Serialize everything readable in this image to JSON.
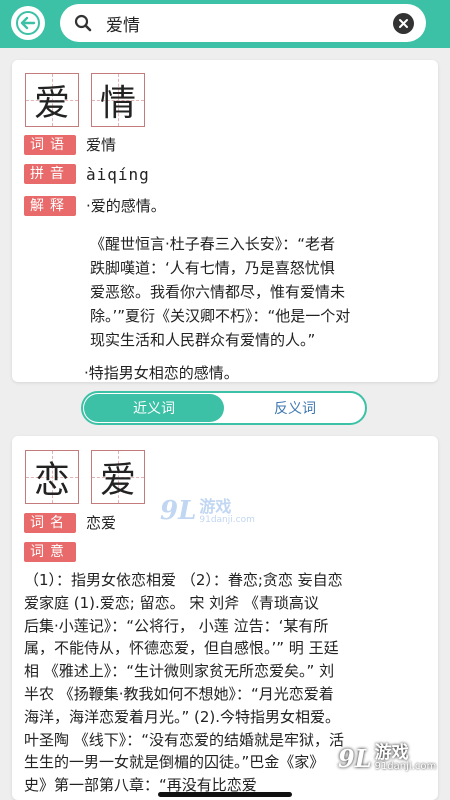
{
  "search": {
    "query": "爱情"
  },
  "primary": {
    "chars": [
      "爱",
      "情"
    ],
    "word_tag": "词语",
    "word": "爱情",
    "pinyin_tag": "拼音",
    "pinyin": "àiqíng",
    "def_tag": "解释",
    "definition": "·爱的感情。",
    "quote_lines": [
      "《醒世恒言·杜子春三入长安》：“老者",
      "跌脚嘆道：‘人有七情，乃是喜怒忧惧",
      "爱恶慾。我看你六情都尽，惟有爱情未",
      "除。’”夏衍《关汉卿不朽》：“他是一个对",
      "现实生活和人民群众有爱情的人。”"
    ],
    "secondary_def": "·特指男女相恋的感情。"
  },
  "tabs": {
    "synonyms": "近义词",
    "antonyms": "反义词"
  },
  "synonym": {
    "chars": [
      "恋",
      "爱"
    ],
    "name_tag": "词名",
    "name": "恋爱",
    "meaning_tag": "词意",
    "meaning_lines": [
      "（1）：指男女依恋相爱 （2）：眷恋;贪恋 妄自恋",
      "爱家庭 (1).爱恋; 留恋。 宋 刘斧 《青琐高议",
      "后集·小莲记》：“公将行， 小莲 泣告：‘某有所",
      "属，不能侍从，怀德恋爱，但自感恨。’” 明 王廷",
      "相 《雅述上》：“生计微则家贫无所恋爱矣。” 刘",
      "半农 《扬鞭集·教我如何不想她》：“月光恋爱着",
      "海洋，海洋恋爱着月光。” (2).今特指男女相爱。",
      "叶圣陶 《线下》：“没有恋爱的结婚就是牢狱，活",
      "生生的一男一女就是倒楣的囚徒。”巴金《家》",
      "史》第一部第八章：“再没有比恋爱"
    ]
  },
  "watermark": {
    "number": "9L",
    "title": "游戏",
    "url_mid": "91danji.com",
    "url_corner": "91danji.com"
  },
  "colors": {
    "accent": "#3cc1a6",
    "tag": "#e86a6a",
    "link": "#3c77b0"
  }
}
